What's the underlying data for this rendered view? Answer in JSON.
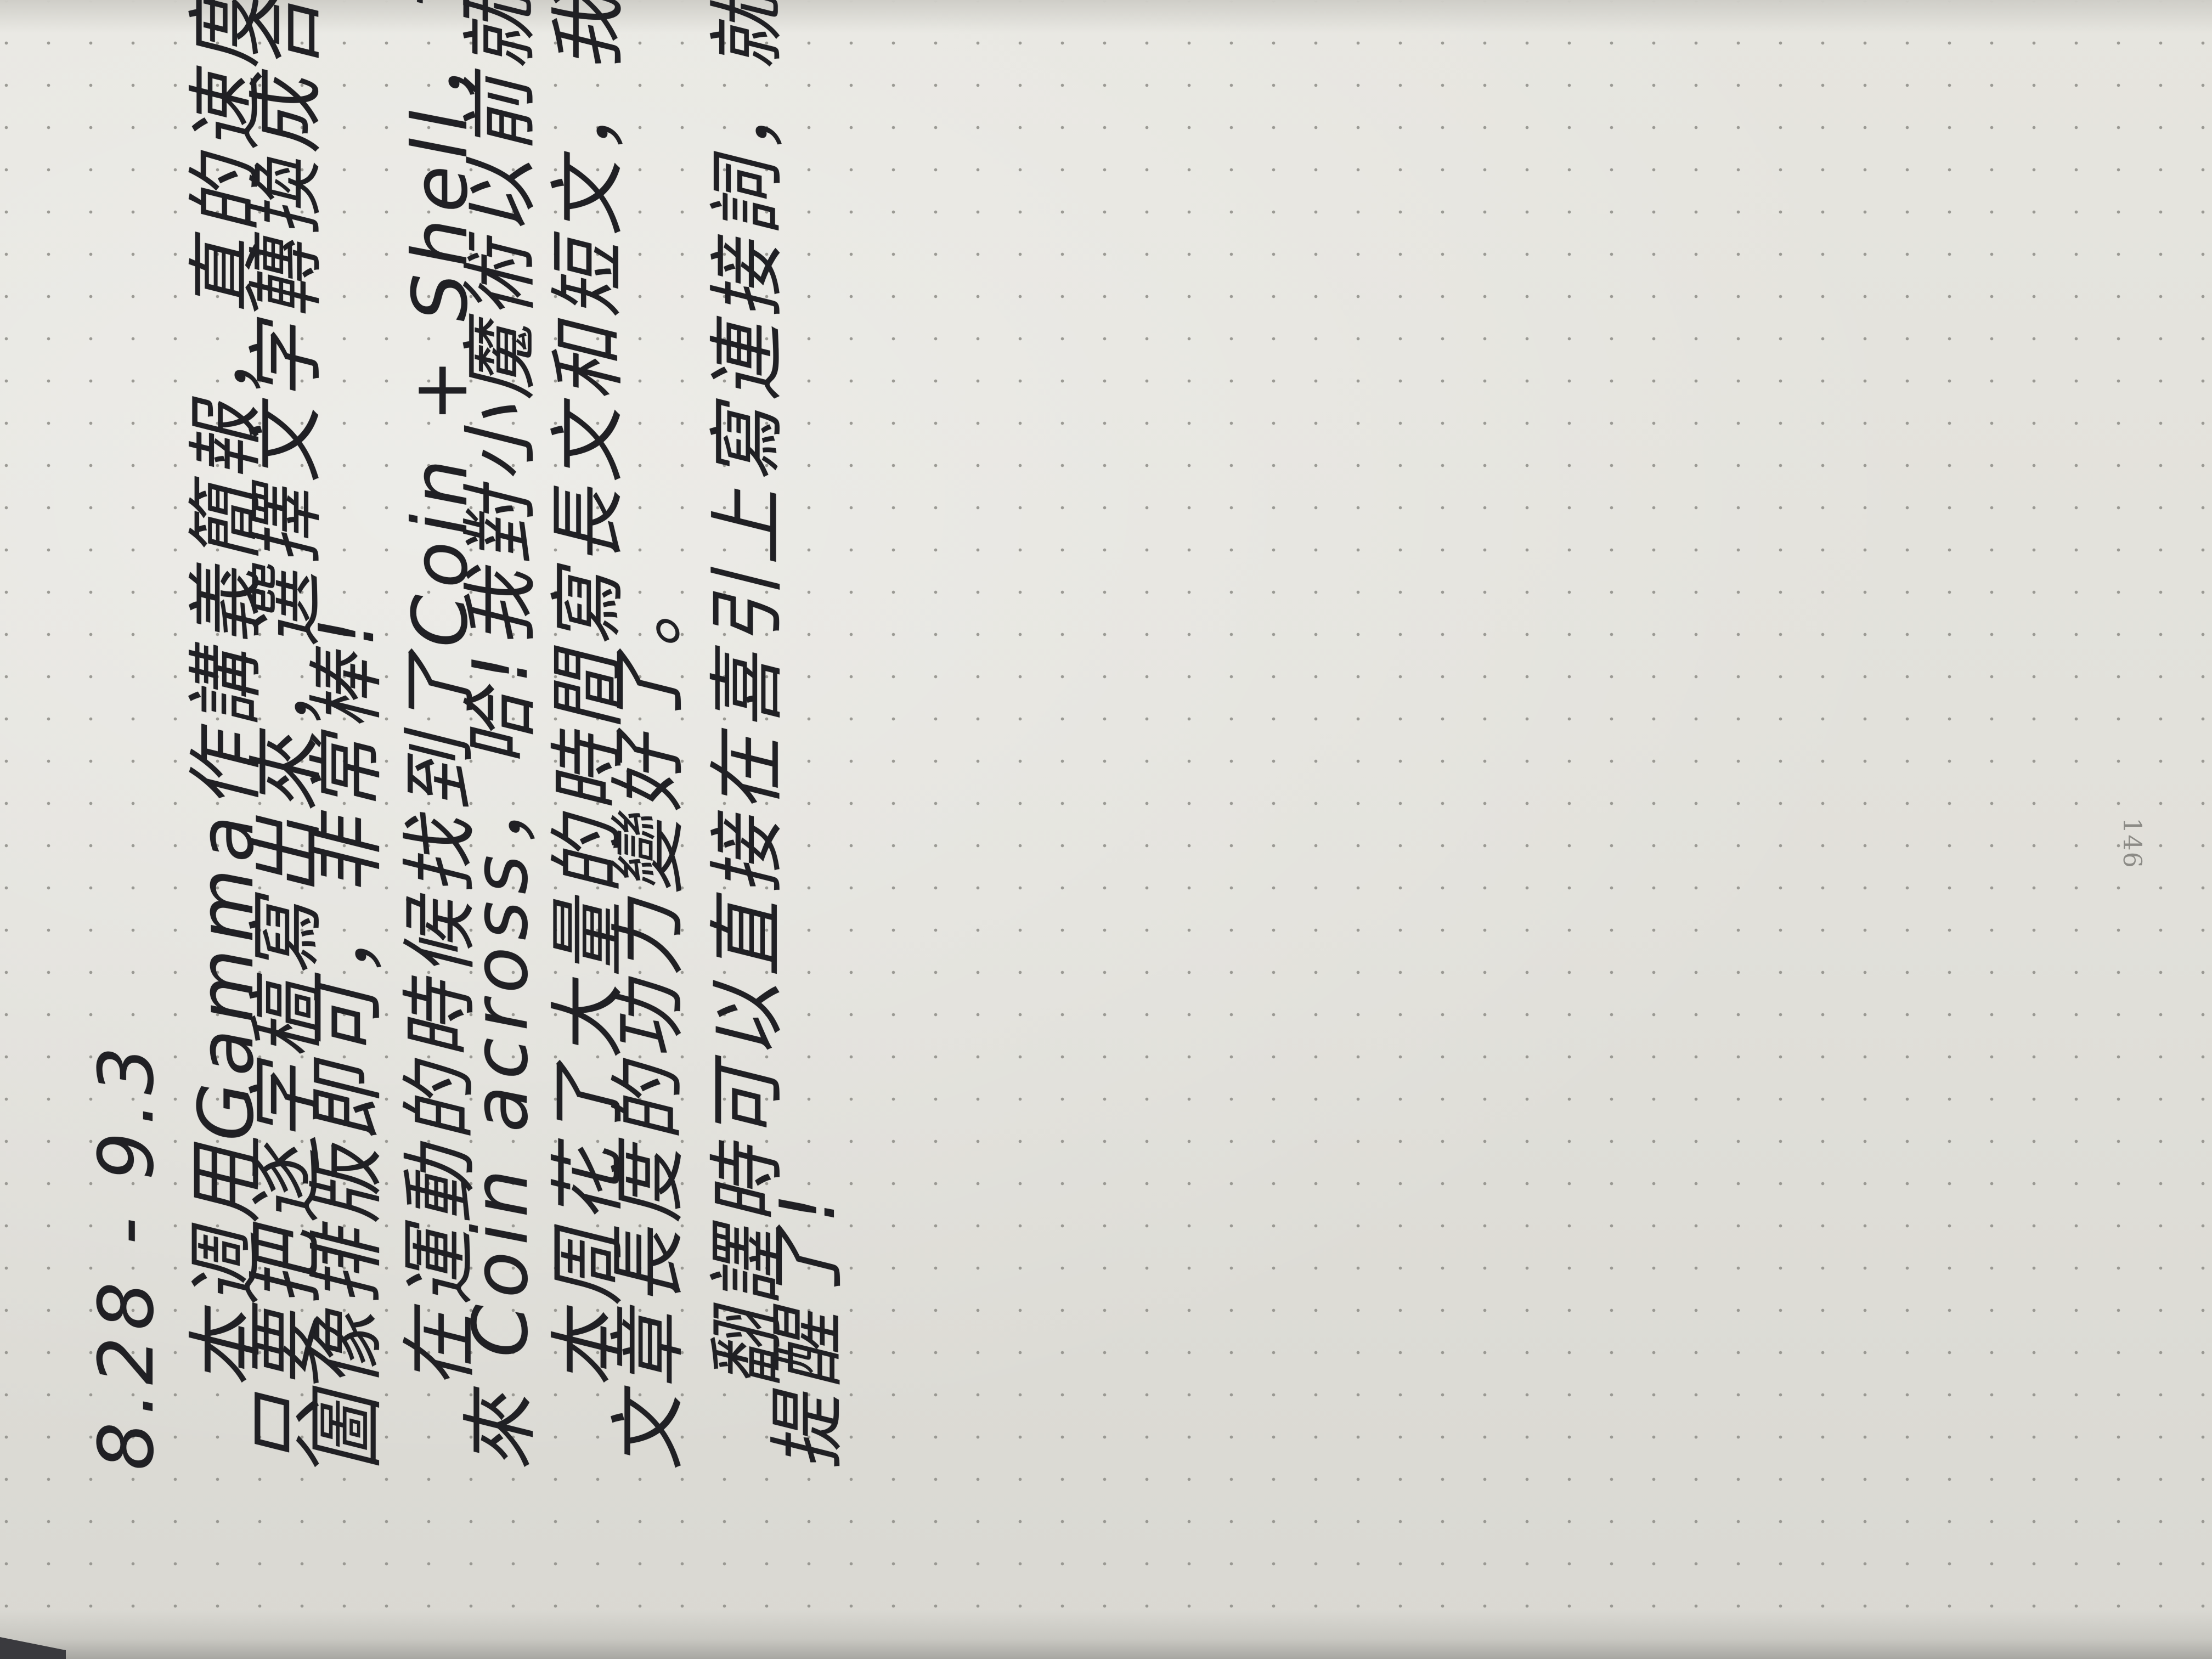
{
  "notebook": {
    "page_number": "146",
    "entry": {
      "date_range": "8.28 - 9.3",
      "paragraphs": [
        {
          "lines": [
            "本週用Gamma作講義簡報，真的速度上快很多!",
            "只要把逐字稿寫出來，選擇文字轉換成合適的",
            "圖像排版即可，非常棒!"
          ]
        },
        {
          "lines": [
            "在運動的時候找到了Coin + Shell，立刻嘗試練起",
            "來 Coin across，哈!我對小魔術以前就非常有Magic的時候。"
          ]
        },
        {
          "lines": [
            "本周花了大量的時間寫長文和短文，我發現自己擴",
            "文章長度的功力變好了。"
          ]
        },
        {
          "lines": [
            "翻譯時可以直接在喜引上寫連接詞，就夠幫手",
            "提醒了!"
          ]
        }
      ]
    }
  }
}
